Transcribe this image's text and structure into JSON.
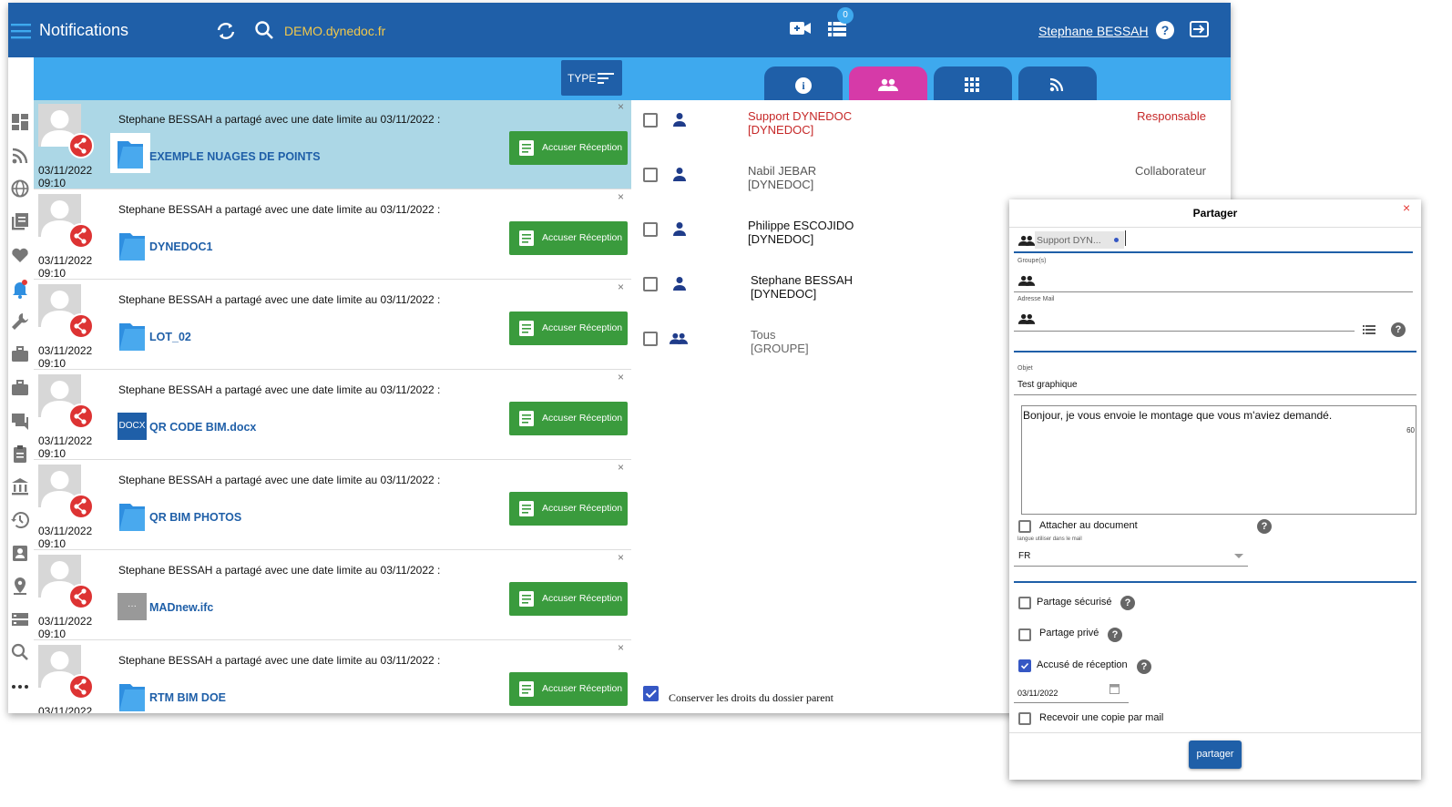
{
  "topbar": {
    "title": "Notifications",
    "domain": "DEMO.dynedoc.fr",
    "badge_count": "0",
    "user": "Stephane BESSAH"
  },
  "filter": {
    "type_label": "TYPE"
  },
  "notifications": [
    {
      "message": "Stephane BESSAH a partagé avec une date limite au 03/11/2022 :",
      "file": "EXEMPLE NUAGES DE POINTS",
      "date": "03/11/2022",
      "time": "09:10",
      "file_type": "folder",
      "button": "Accuser Réception",
      "close": "×"
    },
    {
      "message": "Stephane BESSAH a partagé avec une date limite au 03/11/2022 :",
      "file": "DYNEDOC1",
      "date": "03/11/2022",
      "time": "09:10",
      "file_type": "folder",
      "button": "Accuser Réception",
      "close": "×"
    },
    {
      "message": "Stephane BESSAH a partagé avec une date limite au 03/11/2022 :",
      "file": "LOT_02",
      "date": "03/11/2022",
      "time": "09:10",
      "file_type": "folder",
      "button": "Accuser Réception",
      "close": "×"
    },
    {
      "message": "Stephane BESSAH a partagé avec une date limite au 03/11/2022 :",
      "file": "QR CODE BIM.docx",
      "date": "03/11/2022",
      "time": "09:10",
      "file_type": "docx",
      "type_label": "DOCX",
      "button": "Accuser Réception",
      "close": "×"
    },
    {
      "message": "Stephane BESSAH a partagé avec une date limite au 03/11/2022 :",
      "file": "QR BIM PHOTOS",
      "date": "03/11/2022",
      "time": "09:10",
      "file_type": "folder",
      "button": "Accuser Réception",
      "close": "×"
    },
    {
      "message": "Stephane BESSAH a partagé avec une date limite au 03/11/2022 :",
      "file": "MADnew.ifc",
      "date": "03/11/2022",
      "time": "09:10",
      "file_type": "generic",
      "type_label": "···",
      "button": "Accuser Réception",
      "close": "×"
    },
    {
      "message": "Stephane BESSAH a partagé avec une date limite au 03/11/2022 :",
      "file": "RTM BIM DOE",
      "date": "03/11/2022",
      "time": "",
      "file_type": "folder",
      "button": "Accuser Réception",
      "close": "×"
    }
  ],
  "members": [
    {
      "name": "Support DYNEDOC",
      "org": "[DYNEDOC]",
      "role": "Responsable",
      "kind": "user",
      "highlight": true
    },
    {
      "name": "Nabil JEBAR",
      "org": "[DYNEDOC]",
      "role": "Collaborateur",
      "kind": "user",
      "highlight": false
    },
    {
      "name": "Philippe ESCOJIDO",
      "org": "[DYNEDOC]",
      "role": "",
      "kind": "user",
      "highlight": false
    },
    {
      "name": "Stephane BESSAH",
      "org": "[DYNEDOC]",
      "role": "",
      "kind": "user",
      "highlight": false
    },
    {
      "name": "Tous",
      "org": "[GROUPE]",
      "role": "",
      "kind": "group",
      "highlight": false
    }
  ],
  "inherit_label": "Conserver les droits du dossier parent",
  "dialog": {
    "title": "Partager",
    "close": "×",
    "chip": "Support DYN...",
    "groups_label": "Groupe(s)",
    "mail_label": "Adresse Mail",
    "subject_label": "Objet",
    "subject": "Test graphique",
    "message": "Bonjour, je vous envoie le montage que vous m'aviez demandé.",
    "message_count": "60",
    "attach_label": "Attacher au document",
    "lang_label": "langue utiliser dans le mail",
    "lang": "FR",
    "secure_label": "Partage sécurisé",
    "private_label": "Partage privé",
    "receipt_label": "Accusé de réception",
    "receipt_date": "03/11/2022",
    "copy_label": "Recevoir une copie par mail",
    "submit": "partager",
    "help": "?"
  },
  "colors": {
    "primary": "#1f5fa8",
    "secondary": "#3ea9ee",
    "accept": "#3a9b3d",
    "share": "#d33333",
    "active_tab": "#d63aa8"
  }
}
